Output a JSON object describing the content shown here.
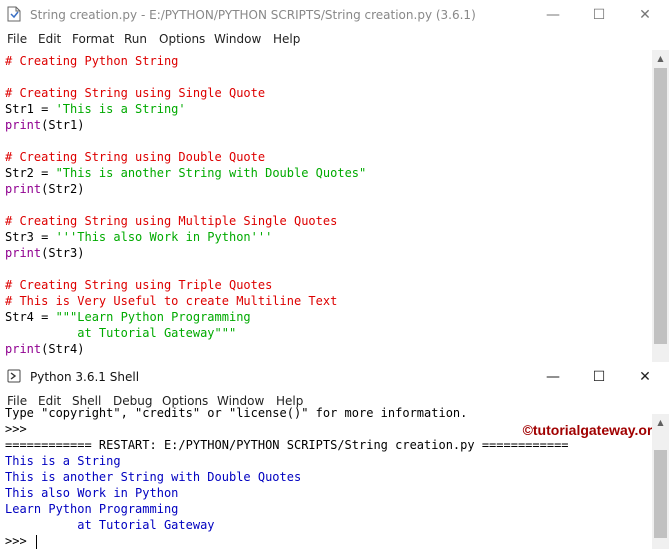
{
  "editor": {
    "title": "String creation.py - E:/PYTHON/PYTHON SCRIPTS/String creation.py (3.6.1)",
    "menu": [
      "File",
      "Edit",
      "Format",
      "Run",
      "Options",
      "Window",
      "Help"
    ],
    "lines": [
      [
        {
          "t": "cm",
          "v": "# Creating Python String"
        }
      ],
      [],
      [
        {
          "t": "cm",
          "v": "# Creating String using Single Quote"
        }
      ],
      [
        {
          "t": "df",
          "v": "Str1 = "
        },
        {
          "t": "st",
          "v": "'This is a String'"
        }
      ],
      [
        {
          "t": "kw",
          "v": "print"
        },
        {
          "t": "df",
          "v": "(Str1)"
        }
      ],
      [],
      [
        {
          "t": "cm",
          "v": "# Creating String using Double Quote"
        }
      ],
      [
        {
          "t": "df",
          "v": "Str2 = "
        },
        {
          "t": "st",
          "v": "\"This is another String with Double Quotes\""
        }
      ],
      [
        {
          "t": "kw",
          "v": "print"
        },
        {
          "t": "df",
          "v": "(Str2)"
        }
      ],
      [],
      [
        {
          "t": "cm",
          "v": "# Creating String using Multiple Single Quotes"
        }
      ],
      [
        {
          "t": "df",
          "v": "Str3 = "
        },
        {
          "t": "st",
          "v": "'''This also Work in Python'''"
        }
      ],
      [
        {
          "t": "kw",
          "v": "print"
        },
        {
          "t": "df",
          "v": "(Str3)"
        }
      ],
      [],
      [
        {
          "t": "cm",
          "v": "# Creating String using Triple Quotes"
        }
      ],
      [
        {
          "t": "cm",
          "v": "# This is Very Useful to create Multiline Text"
        }
      ],
      [
        {
          "t": "df",
          "v": "Str4 = "
        },
        {
          "t": "st",
          "v": "\"\"\"Learn Python Programming"
        }
      ],
      [
        {
          "t": "st",
          "v": "          at Tutorial Gateway\"\"\""
        }
      ],
      [
        {
          "t": "kw",
          "v": "print"
        },
        {
          "t": "df",
          "v": "(Str4)"
        }
      ]
    ]
  },
  "shell": {
    "title": "Python 3.6.1 Shell",
    "menu": [
      "File",
      "Edit",
      "Shell",
      "Debug",
      "Options",
      "Window",
      "Help"
    ],
    "watermark": "©tutorialgateway.org",
    "lines": [
      [
        {
          "t": "df",
          "v": "Type \"copyright\", \"credits\" or \"license()\" for more information."
        }
      ],
      [
        {
          "t": "df",
          "v": ">>> "
        }
      ],
      [
        {
          "t": "df",
          "v": "============ RESTART: E:/PYTHON/PYTHON SCRIPTS/String creation.py ============"
        }
      ],
      [
        {
          "t": "ou",
          "v": "This is a String"
        }
      ],
      [
        {
          "t": "ou",
          "v": "This is another String with Double Quotes"
        }
      ],
      [
        {
          "t": "ou",
          "v": "This also Work in Python"
        }
      ],
      [
        {
          "t": "ou",
          "v": "Learn Python Programming"
        }
      ],
      [
        {
          "t": "ou",
          "v": "          at Tutorial Gateway"
        }
      ]
    ],
    "prompt": ">>> "
  },
  "icons": {
    "minimize": "minimize-icon",
    "maximize": "maximize-icon",
    "close": "close-icon"
  }
}
